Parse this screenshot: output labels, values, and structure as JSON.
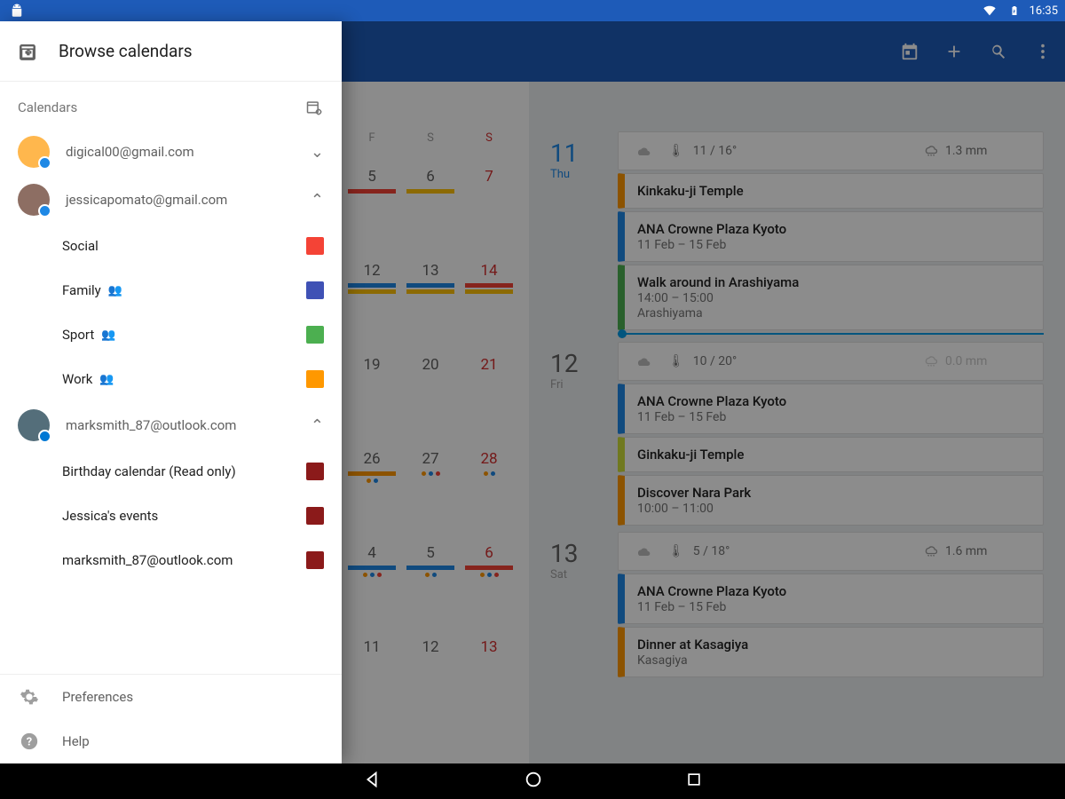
{
  "status": {
    "time": "16:35"
  },
  "drawer": {
    "title": "Browse calendars",
    "section_label": "Calendars",
    "accounts": [
      {
        "email": "digical00@gmail.com",
        "expanded": false
      },
      {
        "email": "jessicapomato@gmail.com",
        "expanded": true,
        "calendars": [
          {
            "name": "Social",
            "shared": false,
            "color": "#f44336"
          },
          {
            "name": "Family",
            "shared": true,
            "color": "#3f51b5"
          },
          {
            "name": "Sport",
            "shared": true,
            "color": "#4caf50"
          },
          {
            "name": "Work",
            "shared": true,
            "color": "#ff9800"
          }
        ]
      },
      {
        "email": "marksmith_87@outlook.com",
        "expanded": true,
        "calendars": [
          {
            "name": "Birthday calendar (Read only)",
            "shared": false,
            "color": "#8b1a1a"
          },
          {
            "name": "Jessica's events",
            "shared": false,
            "color": "#8b1a1a"
          },
          {
            "name": "marksmith_87@outlook.com",
            "shared": false,
            "color": "#8b1a1a"
          }
        ]
      }
    ],
    "footer": {
      "preferences": "Preferences",
      "help": "Help"
    }
  },
  "month": {
    "day_headers": [
      "F",
      "S",
      "S"
    ],
    "weeks": [
      [
        {
          "n": "5",
          "sun": false
        },
        {
          "n": "6",
          "sun": false
        },
        {
          "n": "7",
          "sun": true
        }
      ],
      [
        {
          "n": "12",
          "sun": false
        },
        {
          "n": "13",
          "sun": false
        },
        {
          "n": "14",
          "sun": true
        }
      ],
      [
        {
          "n": "19",
          "sun": false
        },
        {
          "n": "20",
          "sun": false
        },
        {
          "n": "21",
          "sun": true
        }
      ],
      [
        {
          "n": "26",
          "sun": false
        },
        {
          "n": "27",
          "sun": false
        },
        {
          "n": "28",
          "sun": true
        }
      ],
      [
        {
          "n": "4",
          "sun": false
        },
        {
          "n": "5",
          "sun": false
        },
        {
          "n": "6",
          "sun": true
        }
      ],
      [
        {
          "n": "11",
          "sun": false
        },
        {
          "n": "12",
          "sun": false
        },
        {
          "n": "13",
          "sun": true
        }
      ]
    ]
  },
  "agenda": [
    {
      "date": "11",
      "weekday": "Thu",
      "selected": true,
      "weather": {
        "temp": "11 / 16°",
        "rain": "1.3 mm",
        "faded": false
      },
      "events": [
        {
          "title": "Kinkaku-ji Temple",
          "color": "#ff9800"
        },
        {
          "title": "ANA Crowne Plaza Kyoto",
          "sub": "11 Feb – 15 Feb",
          "color": "#1e88e5"
        },
        {
          "title": "Walk around in Arashiyama",
          "sub": "14:00 – 15:00",
          "sub2": "Arashiyama",
          "color": "#4caf50"
        }
      ],
      "now_marker": true
    },
    {
      "date": "12",
      "weekday": "Fri",
      "selected": false,
      "weather": {
        "temp": "10 / 20°",
        "rain": "0.0 mm",
        "faded": true
      },
      "events": [
        {
          "title": "ANA Crowne Plaza Kyoto",
          "sub": "11 Feb – 15 Feb",
          "color": "#1e88e5"
        },
        {
          "title": "Ginkaku-ji Temple",
          "color": "#cddc39"
        },
        {
          "title": "Discover Nara Park",
          "sub": "10:00 – 11:00",
          "color": "#ff9800"
        }
      ]
    },
    {
      "date": "13",
      "weekday": "Sat",
      "selected": false,
      "weather": {
        "temp": "5 / 18°",
        "rain": "1.6 mm",
        "faded": false
      },
      "events": [
        {
          "title": "ANA Crowne Plaza Kyoto",
          "sub": "11 Feb – 15 Feb",
          "color": "#1e88e5"
        },
        {
          "title": "Dinner at Kasagiya",
          "sub": "Kasagiya",
          "color": "#ff9800"
        }
      ]
    }
  ]
}
